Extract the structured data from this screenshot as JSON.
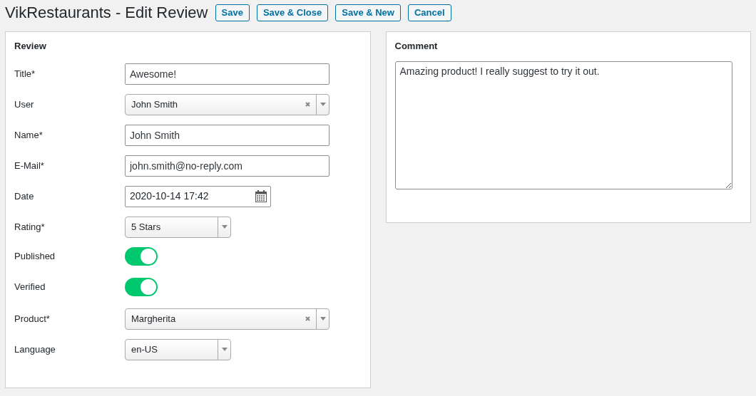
{
  "header": {
    "title": "VikRestaurants - Edit Review",
    "buttons": [
      "Save",
      "Save & Close",
      "Save & New",
      "Cancel"
    ]
  },
  "review": {
    "heading": "Review",
    "fields": [
      {
        "kind": "text",
        "label": "Title*",
        "value": "Awesome!"
      },
      {
        "kind": "select",
        "label": "User",
        "value": "John Smith",
        "clearable": true
      },
      {
        "kind": "text",
        "label": "Name*",
        "value": "John Smith"
      },
      {
        "kind": "text",
        "label": "E-Mail*",
        "value": "john.smith@no-reply.com"
      },
      {
        "kind": "date",
        "label": "Date",
        "value": "2020-10-14 17:42"
      },
      {
        "kind": "select",
        "label": "Rating*",
        "value": "5 Stars",
        "clearable": false
      },
      {
        "kind": "toggle",
        "label": "Published",
        "on": true
      },
      {
        "kind": "toggle",
        "label": "Verified",
        "on": true
      },
      {
        "kind": "select",
        "label": "Product*",
        "value": "Margherita",
        "clearable": true
      },
      {
        "kind": "select",
        "label": "Language",
        "value": "en-US",
        "clearable": false
      }
    ]
  },
  "comment": {
    "heading": "Comment",
    "value": "Amazing product! I really suggest to try it out."
  }
}
